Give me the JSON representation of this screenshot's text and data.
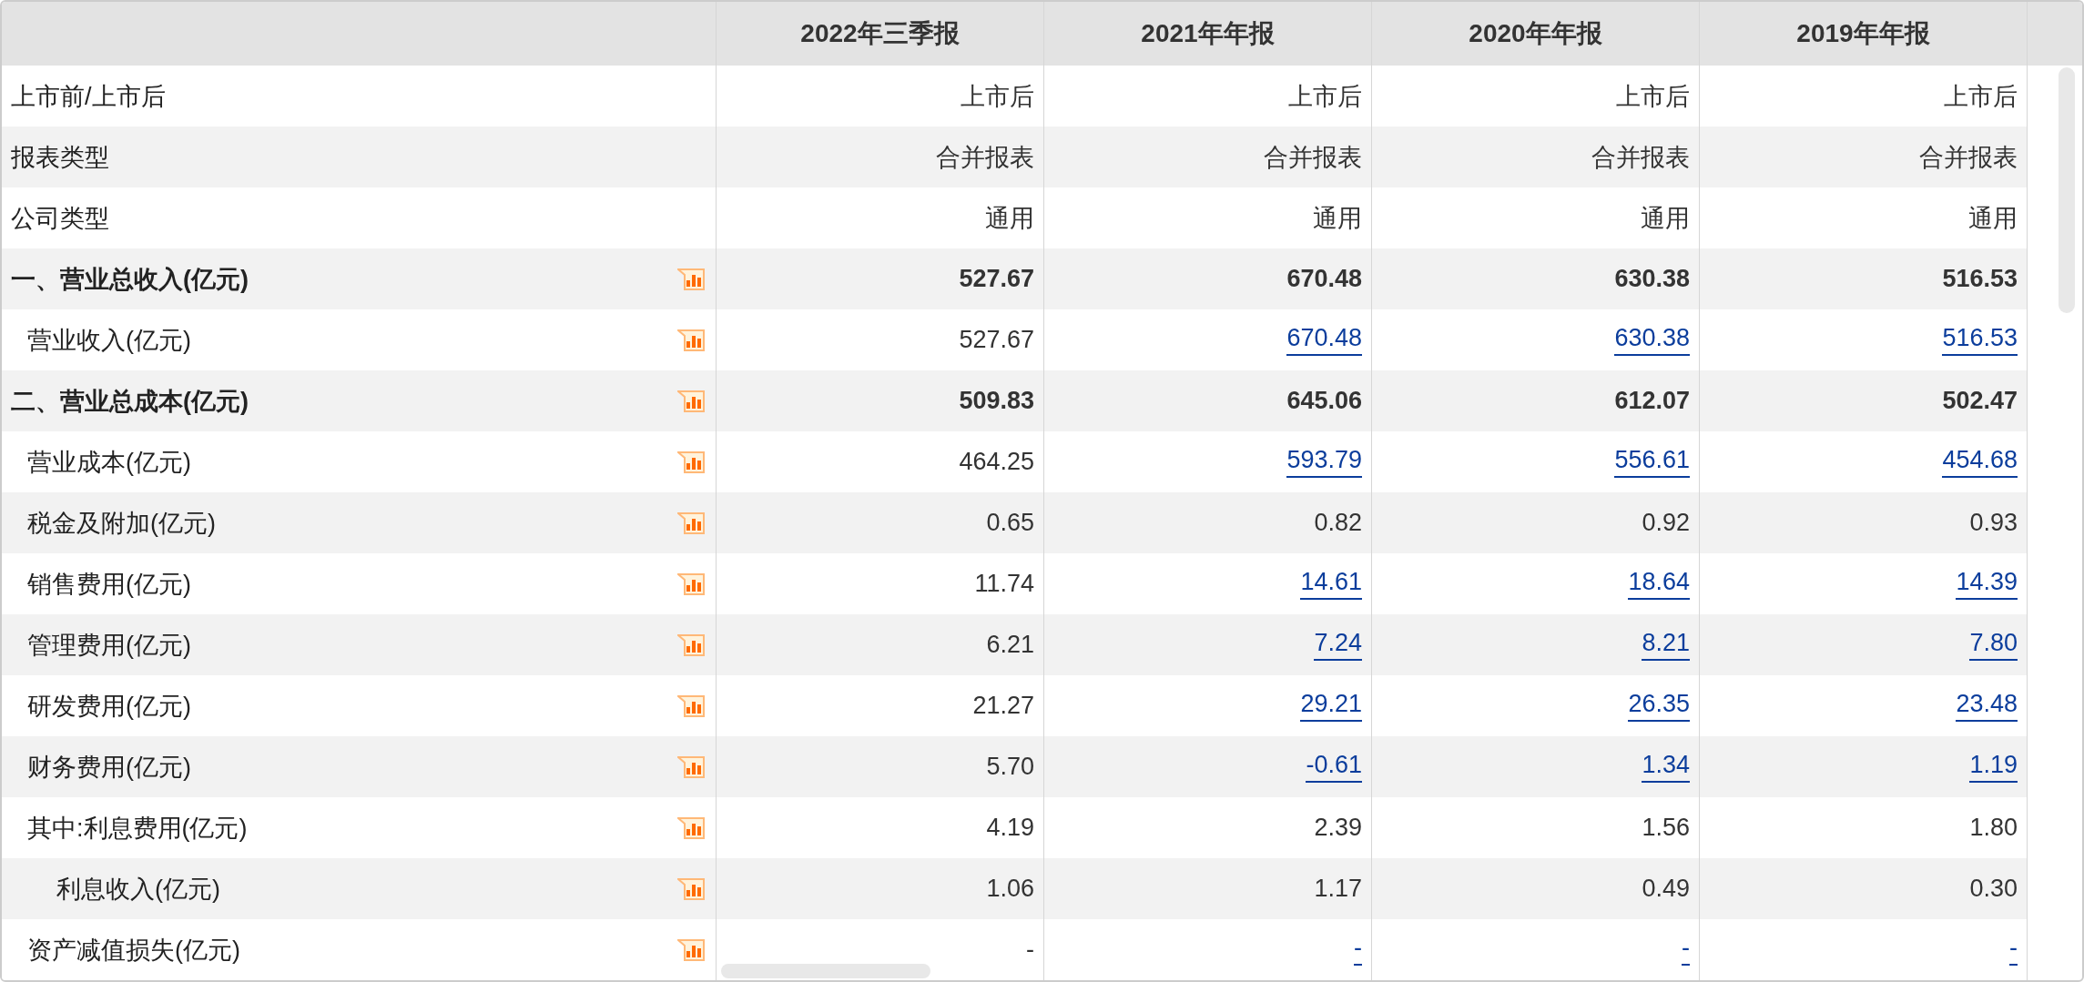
{
  "table": {
    "columns": [
      "2022年三季报",
      "2021年年报",
      "2020年年报",
      "2019年年报"
    ],
    "rows": [
      {
        "label": "上市前/上市后",
        "kind": "meta",
        "cells": [
          {
            "text": "上市后",
            "link": false
          },
          {
            "text": "上市后",
            "link": false
          },
          {
            "text": "上市后",
            "link": false
          },
          {
            "text": "上市后",
            "link": false
          }
        ]
      },
      {
        "label": "报表类型",
        "kind": "meta",
        "cells": [
          {
            "text": "合并报表",
            "link": false
          },
          {
            "text": "合并报表",
            "link": false
          },
          {
            "text": "合并报表",
            "link": false
          },
          {
            "text": "合并报表",
            "link": false
          }
        ]
      },
      {
        "label": "公司类型",
        "kind": "meta",
        "cells": [
          {
            "text": "通用",
            "link": false
          },
          {
            "text": "通用",
            "link": false
          },
          {
            "text": "通用",
            "link": false
          },
          {
            "text": "通用",
            "link": false
          }
        ]
      },
      {
        "label": "一、营业总收入(亿元)",
        "kind": "total",
        "cells": [
          {
            "text": "527.67",
            "link": false
          },
          {
            "text": "670.48",
            "link": false
          },
          {
            "text": "630.38",
            "link": false
          },
          {
            "text": "516.53",
            "link": false
          }
        ],
        "children": [
          {
            "label": "营业收入(亿元)",
            "kind": "item",
            "cells": [
              {
                "text": "527.67",
                "link": false
              },
              {
                "text": "670.48",
                "link": true
              },
              {
                "text": "630.38",
                "link": true
              },
              {
                "text": "516.53",
                "link": true
              }
            ]
          }
        ]
      },
      {
        "label": "二、营业总成本(亿元)",
        "kind": "total",
        "cells": [
          {
            "text": "509.83",
            "link": false
          },
          {
            "text": "645.06",
            "link": false
          },
          {
            "text": "612.07",
            "link": false
          },
          {
            "text": "502.47",
            "link": false
          }
        ],
        "children": [
          {
            "label": "营业成本(亿元)",
            "kind": "item",
            "cells": [
              {
                "text": "464.25",
                "link": false
              },
              {
                "text": "593.79",
                "link": true
              },
              {
                "text": "556.61",
                "link": true
              },
              {
                "text": "454.68",
                "link": true
              }
            ]
          },
          {
            "label": "税金及附加(亿元)",
            "kind": "item",
            "cells": [
              {
                "text": "0.65",
                "link": false
              },
              {
                "text": "0.82",
                "link": false
              },
              {
                "text": "0.92",
                "link": false
              },
              {
                "text": "0.93",
                "link": false
              }
            ]
          },
          {
            "label": "销售费用(亿元)",
            "kind": "item",
            "cells": [
              {
                "text": "11.74",
                "link": false
              },
              {
                "text": "14.61",
                "link": true
              },
              {
                "text": "18.64",
                "link": true
              },
              {
                "text": "14.39",
                "link": true
              }
            ]
          },
          {
            "label": "管理费用(亿元)",
            "kind": "item",
            "cells": [
              {
                "text": "6.21",
                "link": false
              },
              {
                "text": "7.24",
                "link": true
              },
              {
                "text": "8.21",
                "link": true
              },
              {
                "text": "7.80",
                "link": true
              }
            ]
          },
          {
            "label": "研发费用(亿元)",
            "kind": "item",
            "cells": [
              {
                "text": "21.27",
                "link": false
              },
              {
                "text": "29.21",
                "link": true
              },
              {
                "text": "26.35",
                "link": true
              },
              {
                "text": "23.48",
                "link": true
              }
            ]
          },
          {
            "label": "财务费用(亿元)",
            "kind": "item",
            "cells": [
              {
                "text": "5.70",
                "link": false
              },
              {
                "text": "-0.61",
                "link": true
              },
              {
                "text": "1.34",
                "link": true
              },
              {
                "text": "1.19",
                "link": true
              }
            ]
          },
          {
            "label": "其中:利息费用(亿元)",
            "kind": "item",
            "cells": [
              {
                "text": "4.19",
                "link": false
              },
              {
                "text": "2.39",
                "link": false
              },
              {
                "text": "1.56",
                "link": false
              },
              {
                "text": "1.80",
                "link": false
              }
            ],
            "children": [
              {
                "label": "利息收入(亿元)",
                "kind": "item",
                "cells": [
                  {
                    "text": "1.06",
                    "link": false
                  },
                  {
                    "text": "1.17",
                    "link": false
                  },
                  {
                    "text": "0.49",
                    "link": false
                  },
                  {
                    "text": "0.30",
                    "link": false
                  }
                ]
              }
            ]
          },
          {
            "label": "资产减值损失(亿元)",
            "kind": "item",
            "cells": [
              {
                "text": "-",
                "link": false
              },
              {
                "text": "-",
                "link": true
              },
              {
                "text": "-",
                "link": true
              },
              {
                "text": "-",
                "link": true
              }
            ]
          }
        ]
      }
    ]
  }
}
